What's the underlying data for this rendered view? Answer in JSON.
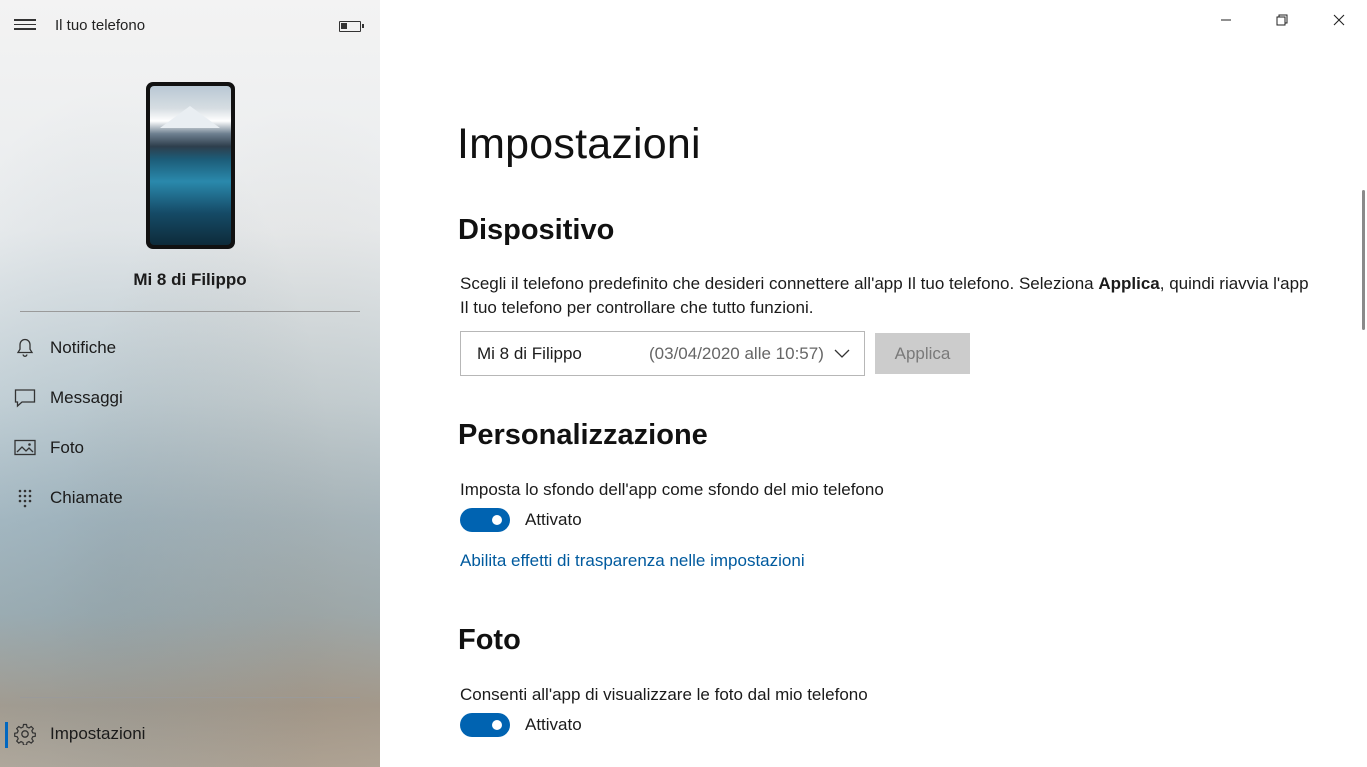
{
  "window": {
    "title": "Il tuo telefono",
    "controls": {
      "minimize_icon": "minimize-icon",
      "maximize_icon": "restore-icon",
      "close_icon": "close-icon"
    }
  },
  "sidebar": {
    "menu_icon": "hamburger-icon",
    "battery_icon": "battery-low-icon",
    "device_name": "Mi 8 di Filippo",
    "items": [
      {
        "label": "Notifiche",
        "icon": "bell-icon"
      },
      {
        "label": "Messaggi",
        "icon": "chat-icon"
      },
      {
        "label": "Foto",
        "icon": "photo-icon"
      },
      {
        "label": "Chiamate",
        "icon": "dialpad-icon"
      }
    ],
    "settings": {
      "label": "Impostazioni",
      "icon": "gear-icon",
      "active": true
    }
  },
  "main": {
    "title": "Impostazioni",
    "device_section": {
      "title": "Dispositivo",
      "description_part1": "Scegli il telefono predefinito che desideri connettere all'app Il tuo telefono. Seleziona ",
      "description_bold": "Applica",
      "description_part2": ", quindi riavvia l'app Il tuo telefono per controllare che tutto funzioni.",
      "dropdown_name": "Mi 8 di Filippo",
      "dropdown_date": "(03/04/2020 alle 10:57)",
      "apply_label": "Applica"
    },
    "personalization_section": {
      "title": "Personalizzazione",
      "option_label": "Imposta lo sfondo dell'app come sfondo del mio telefono",
      "toggle_state": "Attivato",
      "link_text": "Abilita effetti di trasparenza nelle impostazioni"
    },
    "photos_section": {
      "title": "Foto",
      "option_label": "Consenti all'app di visualizzare le foto dal mio telefono",
      "toggle_state": "Attivato"
    }
  },
  "colors": {
    "accent": "#0063b1",
    "link": "#005a9e",
    "disabled_button": "#cccccc"
  }
}
